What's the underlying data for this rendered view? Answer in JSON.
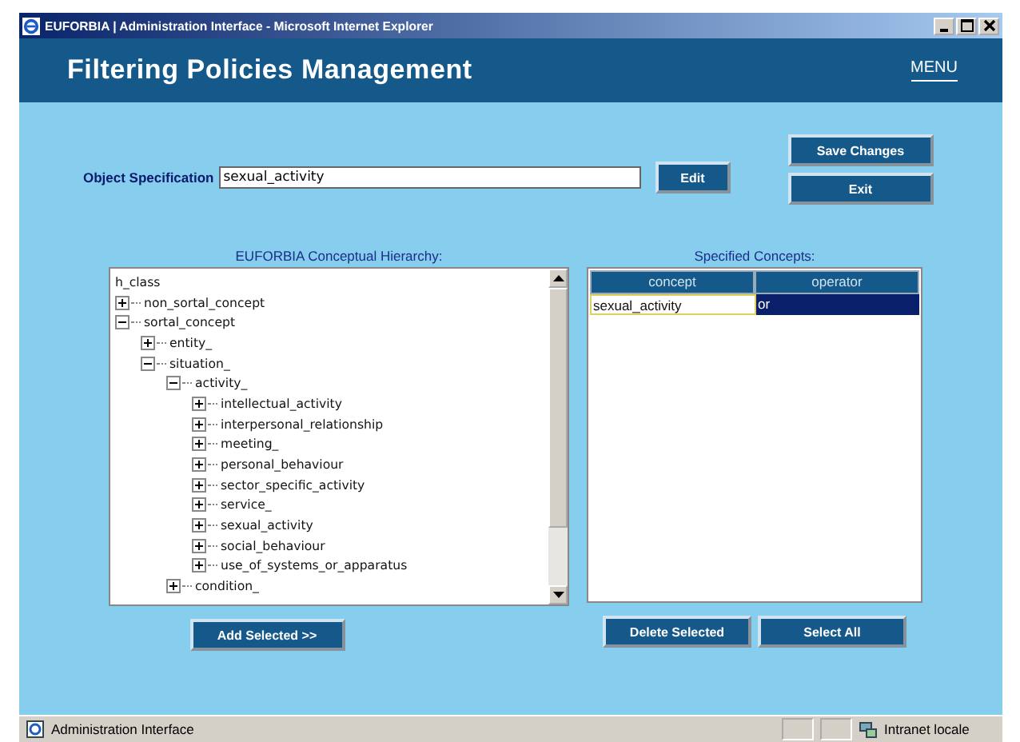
{
  "window": {
    "title": "EUFORBIA | Administration Interface - Microsoft Internet Explorer"
  },
  "header": {
    "title": "Filtering Policies Management",
    "menu": "MENU"
  },
  "object_specification": {
    "label": "Object Specification",
    "value": "sexual_activity",
    "edit_button": "Edit"
  },
  "side_buttons": [
    "Save Changes",
    "Exit"
  ],
  "tree": {
    "heading": "EUFORBIA Conceptual Hierarchy:",
    "root": "h_class",
    "items": [
      {
        "label": "non_sortal_concept",
        "expanded": false
      },
      {
        "label": "sortal_concept",
        "expanded": true,
        "children": [
          {
            "label": "entity_",
            "expanded": false
          },
          {
            "label": "situation_",
            "expanded": true,
            "children": [
              {
                "label": "activity_",
                "expanded": true,
                "children": [
                  {
                    "label": "intellectual_activity",
                    "expanded": false
                  },
                  {
                    "label": "interpersonal_relationship",
                    "expanded": false
                  },
                  {
                    "label": "meeting_",
                    "expanded": false
                  },
                  {
                    "label": "personal_behaviour",
                    "expanded": false
                  },
                  {
                    "label": "sector_specific_activity",
                    "expanded": false
                  },
                  {
                    "label": "service_",
                    "expanded": false
                  },
                  {
                    "label": "sexual_activity",
                    "expanded": false
                  },
                  {
                    "label": "social_behaviour",
                    "expanded": false
                  },
                  {
                    "label": "use_of_systems_or_apparatus",
                    "expanded": false
                  }
                ]
              },
              {
                "label": "condition_",
                "expanded": false
              }
            ]
          }
        ]
      }
    ]
  },
  "concepts": {
    "heading": "Specified Concepts:",
    "columns": [
      "concept",
      "operator"
    ],
    "rows": [
      {
        "concept": "sexual_activity",
        "operator": "or",
        "selected": true
      }
    ]
  },
  "buttons": {
    "add": "Add Selected >>",
    "delete": "Delete Selected",
    "select_all": "Select  All"
  },
  "status_bar": {
    "text": "Administration Interface",
    "zone": "Intranet locale"
  }
}
